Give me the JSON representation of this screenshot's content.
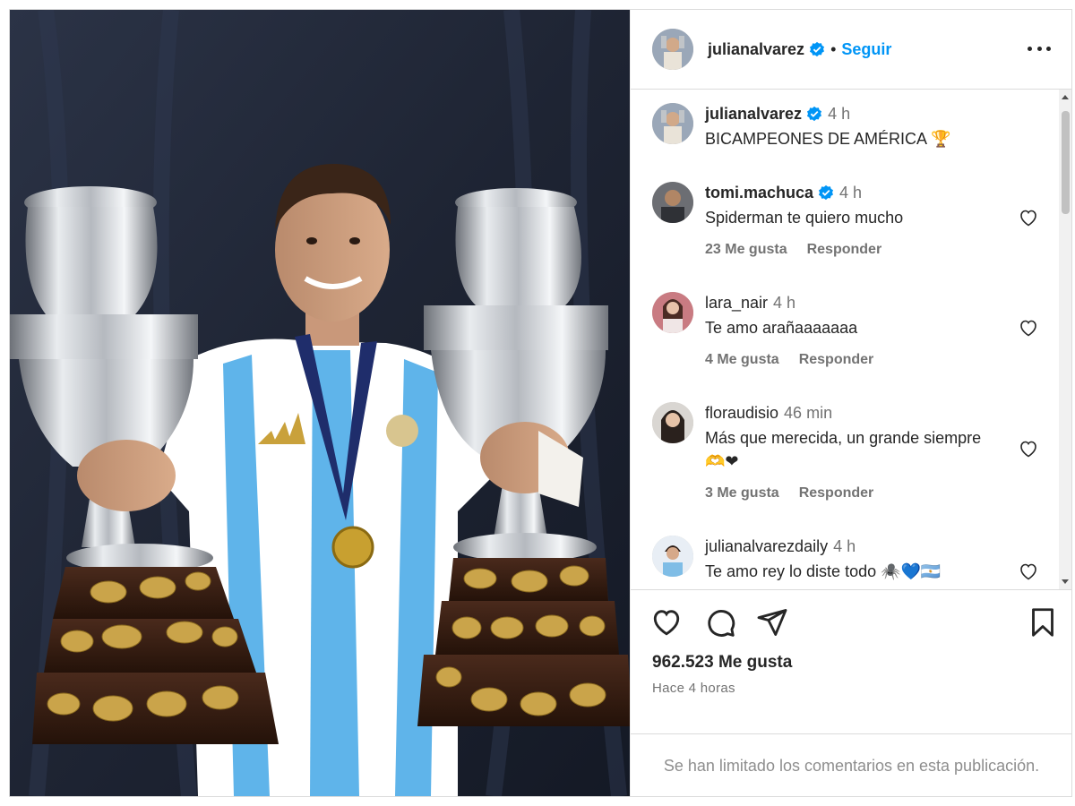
{
  "post": {
    "username": "julianalvarez",
    "follow_label": "Seguir",
    "separator": "•",
    "likes_label": "962.523 Me gusta",
    "time_ago_label": "Hace 4 horas",
    "comments_limited_notice": "Se han limitado los comentarios en esta publicación."
  },
  "caption": {
    "username": "julianalvarez",
    "time": "4 h",
    "text": "BICAMPEONES DE AMÉRICA",
    "emoji": "🏆"
  },
  "comments": [
    {
      "username": "tomi.machuca",
      "verified": true,
      "time": "4 h",
      "text": "Spiderman te quiero mucho",
      "likes": "23 Me gusta",
      "reply": "Responder"
    },
    {
      "username": "lara_nair",
      "verified": false,
      "time": "4 h",
      "text": "Te amo arañaaaaaaa",
      "likes": "4 Me gusta",
      "reply": "Responder"
    },
    {
      "username": "floraudisio",
      "verified": false,
      "time": "46 min",
      "text": "Más que merecida, un grande siempre 🫶❤",
      "likes": "3 Me gusta",
      "reply": "Responder"
    },
    {
      "username": "julianalvarezdaily",
      "verified": false,
      "time": "4 h",
      "text": "Te amo rey lo diste todo 🕷️💙🇦🇷",
      "likes": "",
      "reply": ""
    }
  ],
  "icons": {
    "like": "heart-icon",
    "comment": "comment-icon",
    "share": "share-icon",
    "save": "bookmark-icon",
    "more": "more-options-icon",
    "verified": "verified-badge-icon"
  },
  "colors": {
    "accent": "#0095f6",
    "verified": "#0095f6",
    "text": "#262626",
    "muted": "#737373",
    "border": "#dbdbdb"
  }
}
